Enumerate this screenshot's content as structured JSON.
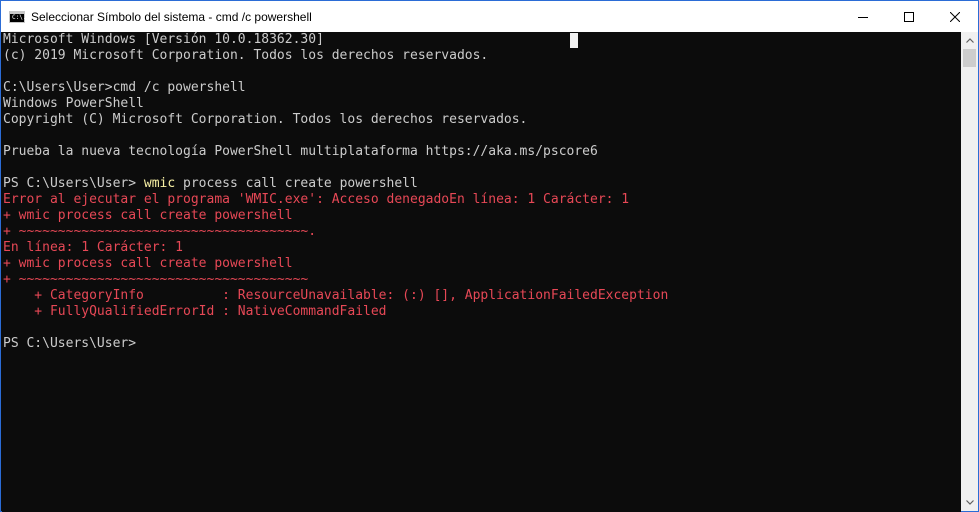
{
  "window": {
    "title": "Seleccionar Símbolo del sistema - cmd  /c powershell",
    "app_icon": "cmd-icon",
    "app_icon_text": "C:\\.",
    "controls": [
      "minimize-icon",
      "maximize-icon",
      "close-icon"
    ]
  },
  "console": {
    "lines": [
      {
        "text": "Microsoft Windows [Versión 10.0.18362.30]",
        "type": "normal"
      },
      {
        "text": "(c) 2019 Microsoft Corporation. Todos los derechos reservados.",
        "type": "normal"
      },
      {
        "text": "",
        "type": "normal"
      },
      {
        "text": "C:\\Users\\User>cmd /c powershell",
        "type": "normal"
      },
      {
        "text": "Windows PowerShell",
        "type": "normal"
      },
      {
        "text": "Copyright (C) Microsoft Corporation. Todos los derechos reservados.",
        "type": "normal"
      },
      {
        "text": "",
        "type": "normal"
      },
      {
        "text": "Prueba la nueva tecnología PowerShell multiplataforma https://aka.ms/pscore6",
        "type": "normal"
      },
      {
        "text": "",
        "type": "normal"
      },
      {
        "prompt": "PS C:\\Users\\User> ",
        "command": "wmic",
        "rest": " process call create powershell",
        "type": "prompt-cmd"
      },
      {
        "text": "Error al ejecutar el programa 'WMIC.exe': Acceso denegadoEn línea: 1 Carácter: 1",
        "type": "error"
      },
      {
        "text": "+ wmic process call create powershell",
        "type": "error"
      },
      {
        "text": "+ ~~~~~~~~~~~~~~~~~~~~~~~~~~~~~~~~~~~~~.",
        "type": "error"
      },
      {
        "text": "En línea: 1 Carácter: 1",
        "type": "error"
      },
      {
        "text": "+ wmic process call create powershell",
        "type": "error"
      },
      {
        "text": "+ ~~~~~~~~~~~~~~~~~~~~~~~~~~~~~~~~~~~~~",
        "type": "error"
      },
      {
        "text": "    + CategoryInfo          : ResourceUnavailable: (:) [], ApplicationFailedException",
        "type": "error"
      },
      {
        "text": "    + FullyQualifiedErrorId : NativeCommandFailed",
        "type": "error"
      },
      {
        "text": "",
        "type": "normal"
      },
      {
        "text": "PS C:\\Users\\User>",
        "type": "normal"
      }
    ]
  },
  "colors": {
    "background": "#0c0c0c",
    "text": "#cccccc",
    "error": "#e74856",
    "command_highlight": "#f9f1a5",
    "window_border": "#2b6cd6"
  }
}
